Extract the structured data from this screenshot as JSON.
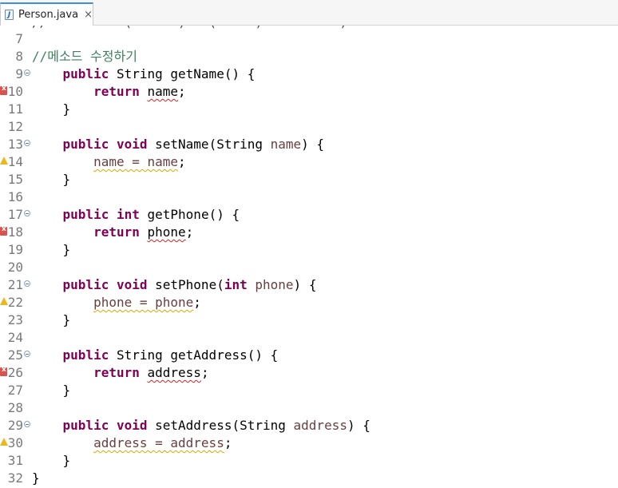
{
  "tab": {
    "icon": "java-file-icon",
    "label": "Person.java",
    "close_glyph": "×"
  },
  "editor": {
    "partial_line_text": "//          (      )   (     )          )",
    "lines": [
      {
        "n": "7",
        "marker": "",
        "fold": false,
        "tokens": []
      },
      {
        "n": "8",
        "marker": "",
        "fold": false,
        "tokens": [
          {
            "t": "//메소드 수정하기",
            "c": "cm"
          }
        ]
      },
      {
        "n": "9",
        "marker": "",
        "fold": true,
        "tokens": [
          {
            "t": "    ",
            "c": ""
          },
          {
            "t": "public",
            "c": "kw"
          },
          {
            "t": " String getName() {",
            "c": ""
          }
        ]
      },
      {
        "n": "10",
        "marker": "error",
        "fold": false,
        "tokens": [
          {
            "t": "        ",
            "c": ""
          },
          {
            "t": "return",
            "c": "kw"
          },
          {
            "t": " ",
            "c": ""
          },
          {
            "t": "name",
            "c": "err"
          },
          {
            "t": ";",
            "c": ""
          }
        ]
      },
      {
        "n": "11",
        "marker": "",
        "fold": false,
        "tokens": [
          {
            "t": "    }",
            "c": ""
          }
        ]
      },
      {
        "n": "12",
        "marker": "",
        "fold": false,
        "tokens": []
      },
      {
        "n": "13",
        "marker": "",
        "fold": true,
        "tokens": [
          {
            "t": "    ",
            "c": ""
          },
          {
            "t": "public",
            "c": "kw"
          },
          {
            "t": " ",
            "c": ""
          },
          {
            "t": "void",
            "c": "kw"
          },
          {
            "t": " setName(String ",
            "c": ""
          },
          {
            "t": "name",
            "c": "param"
          },
          {
            "t": ") {",
            "c": ""
          }
        ]
      },
      {
        "n": "14",
        "marker": "warning",
        "fold": false,
        "tokens": [
          {
            "t": "        ",
            "c": ""
          },
          {
            "t": "name = name",
            "c": "wrn param"
          },
          {
            "t": ";",
            "c": ""
          }
        ]
      },
      {
        "n": "15",
        "marker": "",
        "fold": false,
        "tokens": [
          {
            "t": "    }",
            "c": ""
          }
        ]
      },
      {
        "n": "16",
        "marker": "",
        "fold": false,
        "tokens": []
      },
      {
        "n": "17",
        "marker": "",
        "fold": true,
        "tokens": [
          {
            "t": "    ",
            "c": ""
          },
          {
            "t": "public",
            "c": "kw"
          },
          {
            "t": " ",
            "c": ""
          },
          {
            "t": "int",
            "c": "kw"
          },
          {
            "t": " getPhone() {",
            "c": ""
          }
        ]
      },
      {
        "n": "18",
        "marker": "error",
        "fold": false,
        "tokens": [
          {
            "t": "        ",
            "c": ""
          },
          {
            "t": "return",
            "c": "kw"
          },
          {
            "t": " ",
            "c": ""
          },
          {
            "t": "phone",
            "c": "err"
          },
          {
            "t": ";",
            "c": ""
          }
        ]
      },
      {
        "n": "19",
        "marker": "",
        "fold": false,
        "tokens": [
          {
            "t": "    }",
            "c": ""
          }
        ]
      },
      {
        "n": "20",
        "marker": "",
        "fold": false,
        "tokens": []
      },
      {
        "n": "21",
        "marker": "",
        "fold": true,
        "tokens": [
          {
            "t": "    ",
            "c": ""
          },
          {
            "t": "public",
            "c": "kw"
          },
          {
            "t": " ",
            "c": ""
          },
          {
            "t": "void",
            "c": "kw"
          },
          {
            "t": " setPhone(",
            "c": ""
          },
          {
            "t": "int",
            "c": "kw"
          },
          {
            "t": " ",
            "c": ""
          },
          {
            "t": "phone",
            "c": "param"
          },
          {
            "t": ") {",
            "c": ""
          }
        ]
      },
      {
        "n": "22",
        "marker": "warning",
        "fold": false,
        "tokens": [
          {
            "t": "        ",
            "c": ""
          },
          {
            "t": "phone = phone",
            "c": "wrn param"
          },
          {
            "t": ";",
            "c": ""
          }
        ]
      },
      {
        "n": "23",
        "marker": "",
        "fold": false,
        "tokens": [
          {
            "t": "    }",
            "c": ""
          }
        ]
      },
      {
        "n": "24",
        "marker": "",
        "fold": false,
        "tokens": []
      },
      {
        "n": "25",
        "marker": "",
        "fold": true,
        "tokens": [
          {
            "t": "    ",
            "c": ""
          },
          {
            "t": "public",
            "c": "kw"
          },
          {
            "t": " String getAddress() {",
            "c": ""
          }
        ]
      },
      {
        "n": "26",
        "marker": "error",
        "fold": false,
        "tokens": [
          {
            "t": "        ",
            "c": ""
          },
          {
            "t": "return",
            "c": "kw"
          },
          {
            "t": " ",
            "c": ""
          },
          {
            "t": "address",
            "c": "err"
          },
          {
            "t": ";",
            "c": ""
          }
        ]
      },
      {
        "n": "27",
        "marker": "",
        "fold": false,
        "tokens": [
          {
            "t": "    }",
            "c": ""
          }
        ]
      },
      {
        "n": "28",
        "marker": "",
        "fold": false,
        "tokens": []
      },
      {
        "n": "29",
        "marker": "",
        "fold": true,
        "tokens": [
          {
            "t": "    ",
            "c": ""
          },
          {
            "t": "public",
            "c": "kw"
          },
          {
            "t": " ",
            "c": ""
          },
          {
            "t": "void",
            "c": "kw"
          },
          {
            "t": " setAddress(String ",
            "c": ""
          },
          {
            "t": "address",
            "c": "param"
          },
          {
            "t": ") {",
            "c": ""
          }
        ]
      },
      {
        "n": "30",
        "marker": "warning",
        "fold": false,
        "tokens": [
          {
            "t": "        ",
            "c": ""
          },
          {
            "t": "address = address",
            "c": "wrn param"
          },
          {
            "t": ";",
            "c": ""
          }
        ]
      },
      {
        "n": "31",
        "marker": "",
        "fold": false,
        "tokens": [
          {
            "t": "    }",
            "c": ""
          }
        ]
      },
      {
        "n": "32",
        "marker": "",
        "fold": false,
        "tokens": [
          {
            "t": "}",
            "c": ""
          }
        ]
      }
    ]
  }
}
